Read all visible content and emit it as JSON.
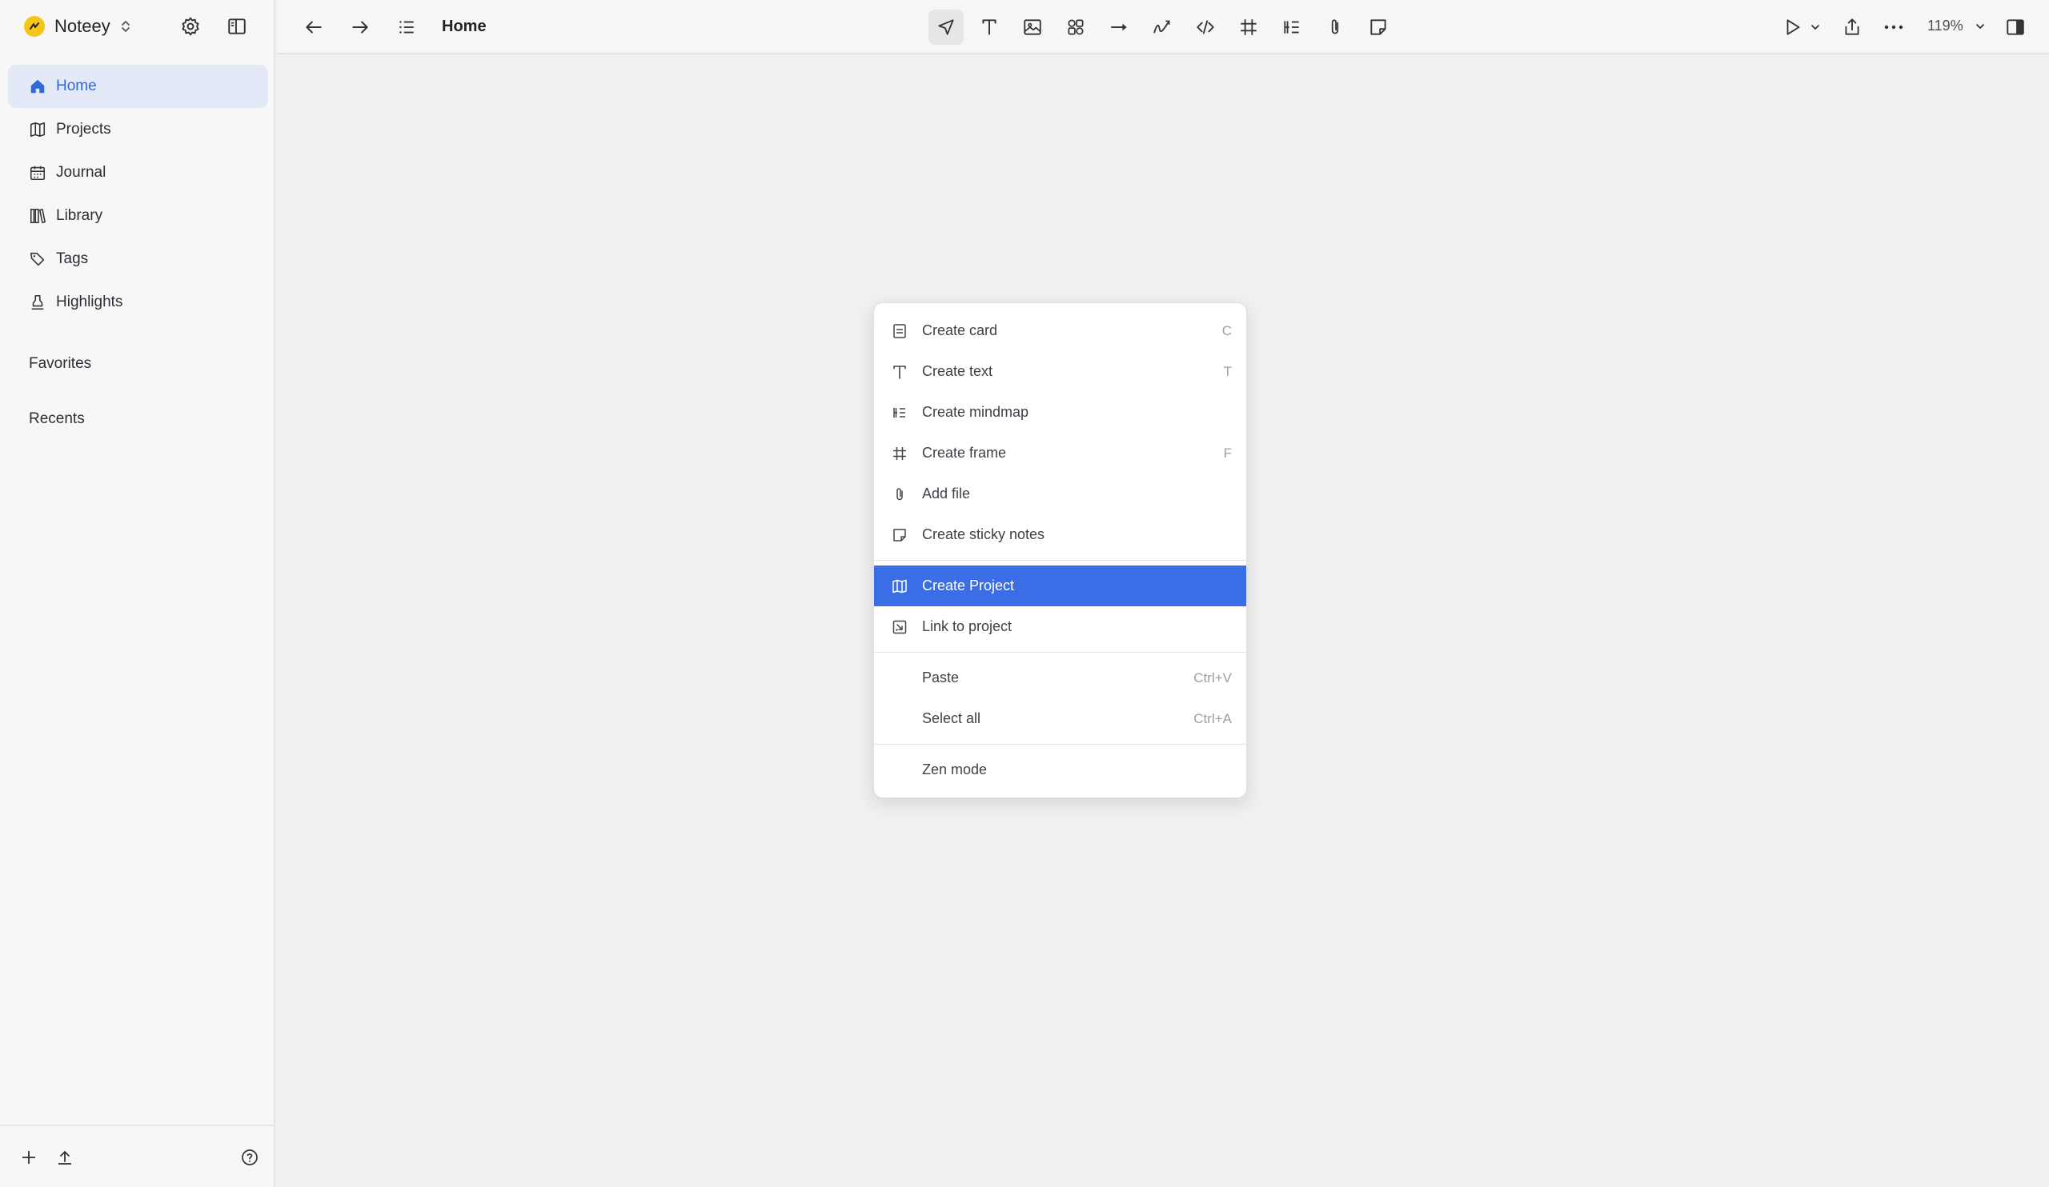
{
  "app": {
    "name": "Noteey"
  },
  "sidebar": {
    "items": [
      {
        "label": "Home",
        "icon": "home-icon",
        "active": true
      },
      {
        "label": "Projects",
        "icon": "map-icon",
        "active": false
      },
      {
        "label": "Journal",
        "icon": "calendar-icon",
        "active": false
      },
      {
        "label": "Library",
        "icon": "library-icon",
        "active": false
      },
      {
        "label": "Tags",
        "icon": "tags-icon",
        "active": false
      },
      {
        "label": "Highlights",
        "icon": "highlighter-icon",
        "active": false
      }
    ],
    "favorites_label": "Favorites",
    "recents_label": "Recents"
  },
  "topbar": {
    "breadcrumb": "Home",
    "zoom": "119%"
  },
  "context_menu": {
    "items": [
      {
        "label": "Create card",
        "shortcut": "C",
        "icon": "card-icon"
      },
      {
        "label": "Create text",
        "shortcut": "T",
        "icon": "text-icon"
      },
      {
        "label": "Create mindmap",
        "shortcut": "",
        "icon": "mindmap-icon"
      },
      {
        "label": "Create frame",
        "shortcut": "F",
        "icon": "frame-icon"
      },
      {
        "label": "Add file",
        "shortcut": "",
        "icon": "paperclip-icon"
      },
      {
        "label": "Create sticky notes",
        "shortcut": "",
        "icon": "sticky-note-icon"
      },
      {
        "label": "Create Project",
        "shortcut": "",
        "icon": "project-map-icon",
        "highlighted": true
      },
      {
        "label": "Link to project",
        "shortcut": "",
        "icon": "link-project-icon"
      },
      {
        "label": "Paste",
        "shortcut": "Ctrl+V"
      },
      {
        "label": "Select all",
        "shortcut": "Ctrl+A"
      },
      {
        "label": "Zen mode",
        "shortcut": ""
      }
    ]
  },
  "colors": {
    "accent": "#3b6ee6",
    "active_nav_bg": "#e3e9f6",
    "active_nav_text": "#2f6bd8",
    "logo": "#f5c518"
  }
}
